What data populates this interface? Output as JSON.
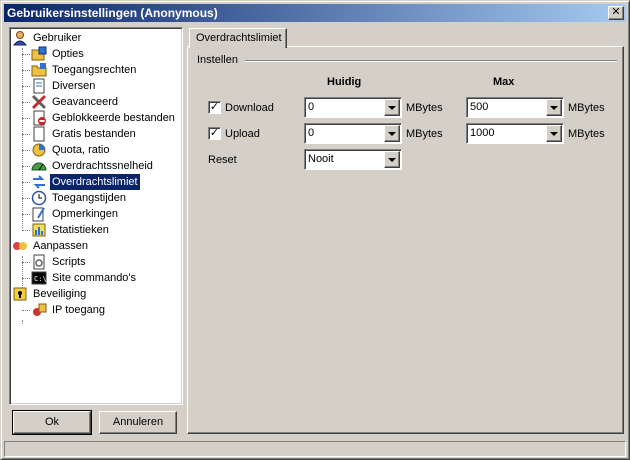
{
  "window": {
    "title": "Gebruikersinstellingen (Anonymous)",
    "close_label": "✕"
  },
  "tree": [
    {
      "label": "Gebruiker",
      "icon": "user-icon",
      "level": 0
    },
    {
      "label": "Opties",
      "icon": "options-icon",
      "level": 1
    },
    {
      "label": "Toegangsrechten",
      "icon": "folder-access-icon",
      "level": 1
    },
    {
      "label": "Diversen",
      "icon": "document-icon",
      "level": 1
    },
    {
      "label": "Geavanceerd",
      "icon": "tools-icon",
      "level": 1
    },
    {
      "label": "Geblokkeerde bestanden",
      "icon": "blocked-file-icon",
      "level": 1
    },
    {
      "label": "Gratis bestanden",
      "icon": "file-icon",
      "level": 1
    },
    {
      "label": "Quota, ratio",
      "icon": "quota-icon",
      "level": 1
    },
    {
      "label": "Overdrachtssnelheid",
      "icon": "speed-gauge-icon",
      "level": 1
    },
    {
      "label": "Overdrachtslimiet",
      "icon": "transfer-limit-icon",
      "level": 1,
      "selected": true
    },
    {
      "label": "Toegangstijden",
      "icon": "clock-icon",
      "level": 1
    },
    {
      "label": "Opmerkingen",
      "icon": "notes-icon",
      "level": 1
    },
    {
      "label": "Statistieken",
      "icon": "stats-icon",
      "level": 1
    },
    {
      "label": "Aanpassen",
      "icon": "customize-icon",
      "level": 0
    },
    {
      "label": "Scripts",
      "icon": "script-icon",
      "level": 1
    },
    {
      "label": "Site commando's",
      "icon": "console-icon",
      "level": 1
    },
    {
      "label": "Beveiliging",
      "icon": "lock-icon",
      "level": 0
    },
    {
      "label": "IP toegang",
      "icon": "ip-access-icon",
      "level": 1
    }
  ],
  "buttons": {
    "ok": "Ok",
    "cancel": "Annuleren"
  },
  "tab": {
    "label": "Overdrachtslimiet"
  },
  "group": {
    "label": "Instellen"
  },
  "columns": {
    "current": "Huidig",
    "max": "Max"
  },
  "rows": {
    "download": {
      "label": "Download",
      "checked": true,
      "current": "0",
      "max": "500",
      "unit": "MBytes"
    },
    "upload": {
      "label": "Upload",
      "checked": true,
      "current": "0",
      "max": "1000",
      "unit": "MBytes"
    },
    "reset": {
      "label": "Reset",
      "value": "Nooit"
    }
  },
  "checkmark": "✓"
}
